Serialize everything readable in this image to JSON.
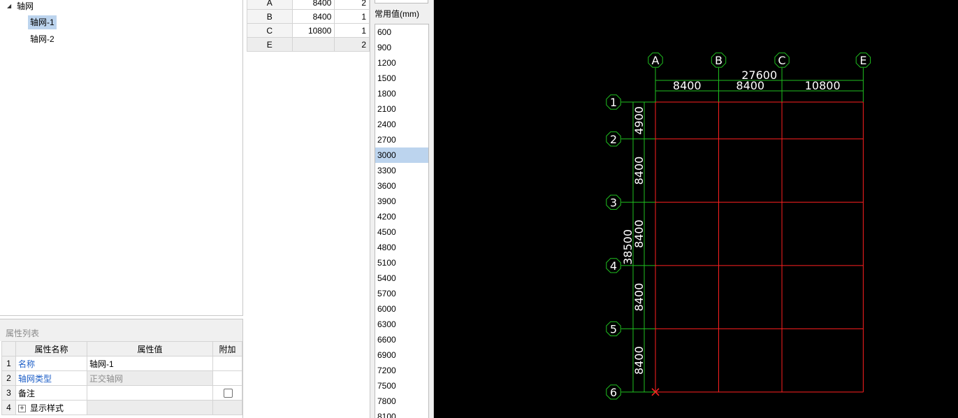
{
  "tree": {
    "root": {
      "label": "轴网",
      "expand_icon": "triangle-down-icon"
    },
    "items": [
      {
        "label": "轴网-1",
        "selected": true
      },
      {
        "label": "轴网-2",
        "selected": false
      }
    ]
  },
  "properties": {
    "title": "属性列表",
    "headers": {
      "name": "属性名称",
      "value": "属性值",
      "extra": "附加"
    },
    "rows": [
      {
        "index": "1",
        "name": "名称",
        "value": "轴网-1"
      },
      {
        "index": "2",
        "name": "轴网类型",
        "value": "正交轴网"
      },
      {
        "index": "3",
        "name": "备注",
        "value": ""
      },
      {
        "index": "4",
        "name": "显示样式",
        "value": ""
      }
    ]
  },
  "axis_table": {
    "rows": [
      {
        "name": "A",
        "distance": "8400",
        "level": "2"
      },
      {
        "name": "B",
        "distance": "8400",
        "level": "1"
      },
      {
        "name": "C",
        "distance": "10800",
        "level": "1"
      },
      {
        "name": "E",
        "distance": "",
        "level": "2"
      }
    ]
  },
  "common_values": {
    "title": "常用值(mm)",
    "selected": "3000",
    "items": [
      "600",
      "900",
      "1200",
      "1500",
      "1800",
      "2100",
      "2400",
      "2700",
      "3000",
      "3300",
      "3600",
      "3900",
      "4200",
      "4500",
      "4800",
      "5100",
      "5400",
      "5700",
      "6000",
      "6300",
      "6600",
      "6900",
      "7200",
      "7500",
      "7800",
      "8100"
    ]
  },
  "cad": {
    "colors": {
      "background": "#000000",
      "grid": "#ff2020",
      "dimension": "#1fbf1f",
      "text": "#ffffff"
    },
    "columns": [
      {
        "label": "A",
        "spacing_after": 8400
      },
      {
        "label": "B",
        "spacing_after": 8400
      },
      {
        "label": "C",
        "spacing_after": 10800
      },
      {
        "label": "E",
        "spacing_after": null
      }
    ],
    "rows": [
      {
        "label": "1",
        "spacing_after": 4900
      },
      {
        "label": "2",
        "spacing_after": 8400
      },
      {
        "label": "3",
        "spacing_after": 8400
      },
      {
        "label": "4",
        "spacing_after": 8400
      },
      {
        "label": "5",
        "spacing_after": 8400
      },
      {
        "label": "6",
        "spacing_after": null
      }
    ],
    "dims": {
      "top_total": "27600",
      "top_segments": [
        "8400",
        "8400",
        "10800"
      ],
      "left_total": "38500",
      "left_segments": [
        "4900",
        "8400",
        "8400",
        "8400",
        "8400"
      ]
    }
  }
}
